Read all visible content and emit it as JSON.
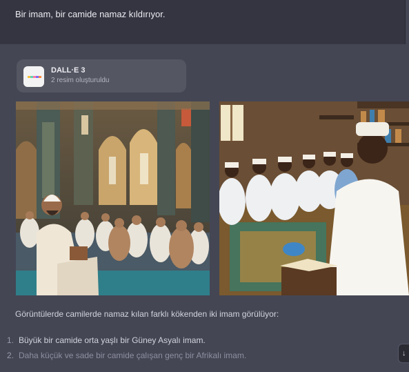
{
  "user_message": {
    "text": "Bir imam, bir camide namaz kıldırıyor."
  },
  "tool": {
    "name": "DALL·E 3",
    "subtitle": "2 resim oluşturuldu",
    "icon": "dalle-palette-icon",
    "palette": [
      "#f5c542",
      "#5fd3b3",
      "#ff7aa2",
      "#7b6cff",
      "#ff8a3d"
    ]
  },
  "images": [
    {
      "icon": "generated-image-mosque-large"
    },
    {
      "icon": "generated-image-mosque-small"
    }
  ],
  "caption": "Görüntülerde camilerde namaz kılan farklı kökenden iki imam görülüyor:",
  "list": [
    {
      "num": "1.",
      "text": "Büyük bir camide orta yaşlı bir Güney Asyalı imam."
    },
    {
      "num": "2.",
      "text": "Daha küçük ve sade bir camide çalışan genç bir Afrikalı imam."
    }
  ],
  "colors": {
    "user_bg": "#343541",
    "assistant_bg": "#444654",
    "card_bg": "#545662"
  }
}
